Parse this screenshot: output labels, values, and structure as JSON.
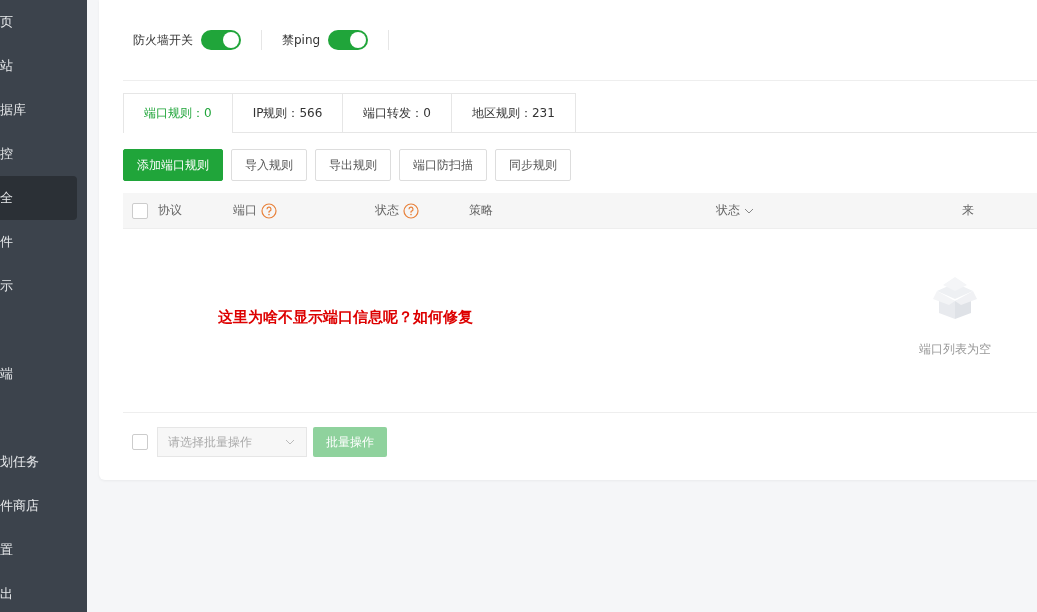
{
  "sidebar": {
    "items": [
      {
        "label": "页",
        "selected": false
      },
      {
        "label": "站",
        "selected": false
      },
      {
        "label": "据库",
        "selected": false
      },
      {
        "label": "控",
        "selected": false
      },
      {
        "label": "全",
        "selected": true
      },
      {
        "label": "件",
        "selected": false
      },
      {
        "label": "示",
        "selected": false
      },
      {
        "selected": false
      },
      {
        "label": "端",
        "selected": false
      },
      {
        "selected": false
      },
      {
        "label": "划任务",
        "selected": false
      },
      {
        "label": "件商店",
        "selected": false
      },
      {
        "label": "置",
        "selected": false
      },
      {
        "label": "出",
        "selected": false
      }
    ]
  },
  "switches": [
    {
      "label": "防火墙开关",
      "on": true
    },
    {
      "label": "禁ping",
      "on": true
    }
  ],
  "tabs": [
    {
      "label": "端口规则：0",
      "selected": true
    },
    {
      "label": "IP规则：566",
      "selected": false
    },
    {
      "label": "端口转发：0",
      "selected": false
    },
    {
      "label": "地区规则：231",
      "selected": false
    }
  ],
  "buttons": [
    {
      "label": "添加端口规则",
      "kind": "primary"
    },
    {
      "label": "导入规则",
      "kind": "default"
    },
    {
      "label": "导出规则",
      "kind": "default"
    },
    {
      "label": "端口防扫描",
      "kind": "default"
    },
    {
      "label": "同步规则",
      "kind": "default"
    }
  ],
  "table": {
    "select_all": {
      "checked": false
    },
    "columns": [
      {
        "label": "协议",
        "kind": "plain"
      },
      {
        "label": "端口",
        "kind": "help"
      },
      {
        "label": "状态",
        "kind": "help"
      },
      {
        "label": "策略",
        "kind": "plain"
      },
      {
        "label": "状态",
        "kind": "sort"
      },
      {
        "label": "来",
        "kind": "plain"
      }
    ],
    "empty_text": "端口列表为空"
  },
  "annotation": "这里为啥不显示端口信息呢？如何修复",
  "footer": {
    "select_all": {
      "checked": false
    },
    "batch_select": {
      "placeholder": "请选择批量操作"
    },
    "batch_button": {
      "label": "批量操作",
      "disabled": true
    }
  }
}
